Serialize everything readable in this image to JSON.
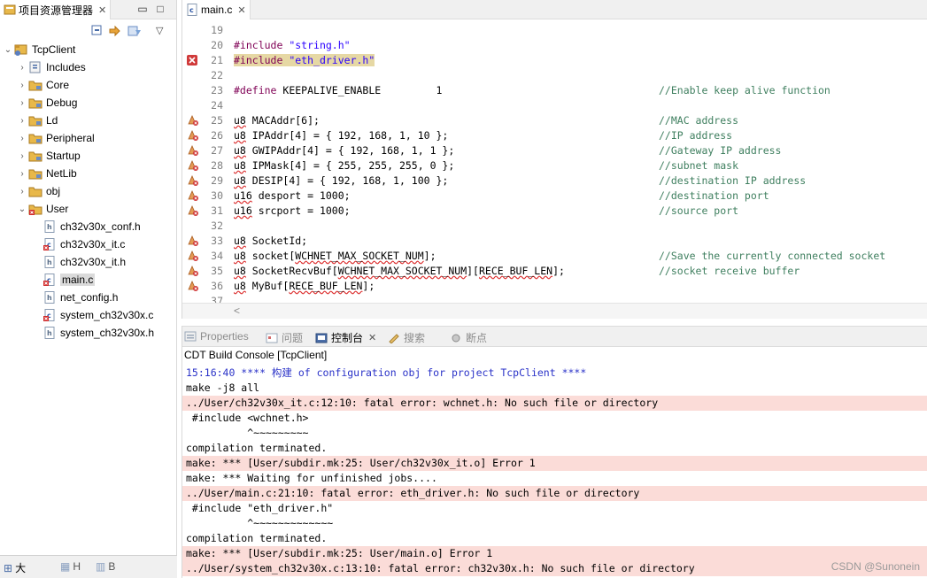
{
  "explorer": {
    "tab_label": "项目资源管理器",
    "close_glyph": "✕",
    "minimize_glyph": "▭",
    "maximize_glyph": "□",
    "menu_glyph": "▽",
    "tree": [
      {
        "label": "TcpClient",
        "depth": 0,
        "expanded": true,
        "icon": "project-icon"
      },
      {
        "label": "Includes",
        "depth": 1,
        "expanded": false,
        "icon": "includes-icon"
      },
      {
        "label": "Core",
        "depth": 1,
        "expanded": false,
        "icon": "folder-icon"
      },
      {
        "label": "Debug",
        "depth": 1,
        "expanded": false,
        "icon": "folder-icon"
      },
      {
        "label": "Ld",
        "depth": 1,
        "expanded": false,
        "icon": "folder-icon"
      },
      {
        "label": "Peripheral",
        "depth": 1,
        "expanded": false,
        "icon": "folder-icon"
      },
      {
        "label": "Startup",
        "depth": 1,
        "expanded": false,
        "icon": "folder-icon"
      },
      {
        "label": "NetLib",
        "depth": 1,
        "expanded": false,
        "icon": "folder-icon"
      },
      {
        "label": "obj",
        "depth": 1,
        "expanded": false,
        "icon": "folder-icon"
      },
      {
        "label": "User",
        "depth": 1,
        "expanded": true,
        "icon": "folder-error-icon"
      },
      {
        "label": "ch32v30x_conf.h",
        "depth": 2,
        "icon": "header-file-icon"
      },
      {
        "label": "ch32v30x_it.c",
        "depth": 2,
        "icon": "c-file-error-icon"
      },
      {
        "label": "ch32v30x_it.h",
        "depth": 2,
        "icon": "header-file-icon"
      },
      {
        "label": "main.c",
        "depth": 2,
        "icon": "c-file-error-icon",
        "selected": true
      },
      {
        "label": "net_config.h",
        "depth": 2,
        "icon": "header-file-icon"
      },
      {
        "label": "system_ch32v30x.c",
        "depth": 2,
        "icon": "c-file-error-icon"
      },
      {
        "label": "system_ch32v30x.h",
        "depth": 2,
        "icon": "header-file-icon"
      }
    ],
    "bottom_tabs": [
      "大",
      "H",
      "B"
    ]
  },
  "editor": {
    "tab_label": "main.c",
    "close_glyph": "✕",
    "scroll_left_glyph": "<",
    "lines": [
      {
        "n": "19",
        "code": "",
        "comment": "",
        "mark": ""
      },
      {
        "n": "20",
        "code": "#include \"string.h\"",
        "comment": "",
        "mark": ""
      },
      {
        "n": "21",
        "code": "#include \"eth_driver.h\"",
        "comment": "",
        "mark": "error"
      },
      {
        "n": "22",
        "code": "",
        "comment": "",
        "mark": ""
      },
      {
        "n": "23",
        "code": "#define KEEPALIVE_ENABLE         1",
        "comment": "//Enable keep alive function",
        "mark": ""
      },
      {
        "n": "24",
        "code": "",
        "comment": "",
        "mark": ""
      },
      {
        "n": "25",
        "code": "u8 MACAddr[6];",
        "comment": "//MAC address",
        "mark": "warn"
      },
      {
        "n": "26",
        "code": "u8 IPAddr[4] = { 192, 168, 1, 10 };",
        "comment": "//IP address",
        "mark": "warn"
      },
      {
        "n": "27",
        "code": "u8 GWIPAddr[4] = { 192, 168, 1, 1 };",
        "comment": "//Gateway IP address",
        "mark": "warn"
      },
      {
        "n": "28",
        "code": "u8 IPMask[4] = { 255, 255, 255, 0 };",
        "comment": "//subnet mask",
        "mark": "warn"
      },
      {
        "n": "29",
        "code": "u8 DESIP[4] = { 192, 168, 1, 100 };",
        "comment": "//destination IP address",
        "mark": "warn"
      },
      {
        "n": "30",
        "code": "u16 desport = 1000;",
        "comment": "//destination port",
        "mark": "warn"
      },
      {
        "n": "31",
        "code": "u16 srcport = 1000;",
        "comment": "//source port",
        "mark": "warn"
      },
      {
        "n": "32",
        "code": "",
        "comment": "",
        "mark": ""
      },
      {
        "n": "33",
        "code": "u8 SocketId;",
        "comment": "",
        "mark": "warn"
      },
      {
        "n": "34",
        "code": "u8 socket[WCHNET_MAX_SOCKET_NUM];",
        "comment": "//Save the currently connected socket",
        "mark": "warn"
      },
      {
        "n": "35",
        "code": "u8 SocketRecvBuf[WCHNET_MAX_SOCKET_NUM][RECE_BUF_LEN];",
        "comment": "//socket receive buffer",
        "mark": "warn"
      },
      {
        "n": "36",
        "code": "u8 MyBuf[RECE_BUF_LEN];",
        "comment": "",
        "mark": "warn"
      },
      {
        "n": "37",
        "code": "",
        "comment": "",
        "mark": ""
      }
    ]
  },
  "console": {
    "tabs": [
      {
        "label": "Properties",
        "icon": "properties-icon",
        "active": false
      },
      {
        "label": "问题",
        "icon": "problems-icon",
        "active": false
      },
      {
        "label": "控制台",
        "icon": "console-icon",
        "active": true
      },
      {
        "label": "搜索",
        "icon": "search-icon",
        "active": false
      },
      {
        "label": "断点",
        "icon": "breakpoints-icon",
        "active": false
      }
    ],
    "title": "CDT Build Console [TcpClient]",
    "lines": [
      {
        "text": "15:16:40 **** 构建 of configuration obj for project TcpClient ****",
        "kind": "info"
      },
      {
        "text": "make -j8 all",
        "kind": "normal"
      },
      {
        "text": "../User/ch32v30x_it.c:12:10: fatal error: wchnet.h: No such file or directory",
        "kind": "err"
      },
      {
        "text": " #include <wchnet.h>",
        "kind": "normal"
      },
      {
        "text": "          ^~~~~~~~~~",
        "kind": "normal"
      },
      {
        "text": "compilation terminated.",
        "kind": "normal"
      },
      {
        "text": "make: *** [User/subdir.mk:25: User/ch32v30x_it.o] Error 1",
        "kind": "err"
      },
      {
        "text": "make: *** Waiting for unfinished jobs....",
        "kind": "normal"
      },
      {
        "text": "../User/main.c:21:10: fatal error: eth_driver.h: No such file or directory",
        "kind": "err"
      },
      {
        "text": " #include \"eth_driver.h\"",
        "kind": "normal"
      },
      {
        "text": "          ^~~~~~~~~~~~~~",
        "kind": "normal"
      },
      {
        "text": "compilation terminated.",
        "kind": "normal"
      },
      {
        "text": "make: *** [User/subdir.mk:25: User/main.o] Error 1",
        "kind": "err"
      },
      {
        "text": "../User/system_ch32v30x.c:13:10: fatal error: ch32v30x.h: No such file or directory",
        "kind": "err"
      }
    ],
    "watermark": "CSDN @Sunonein"
  },
  "colors": {
    "error_line_bg": "#fbdcd8",
    "comment": "#3f7f5f",
    "keyword": "#7f0055",
    "string": "#2a00ff",
    "info_text": "#2a32c8"
  }
}
